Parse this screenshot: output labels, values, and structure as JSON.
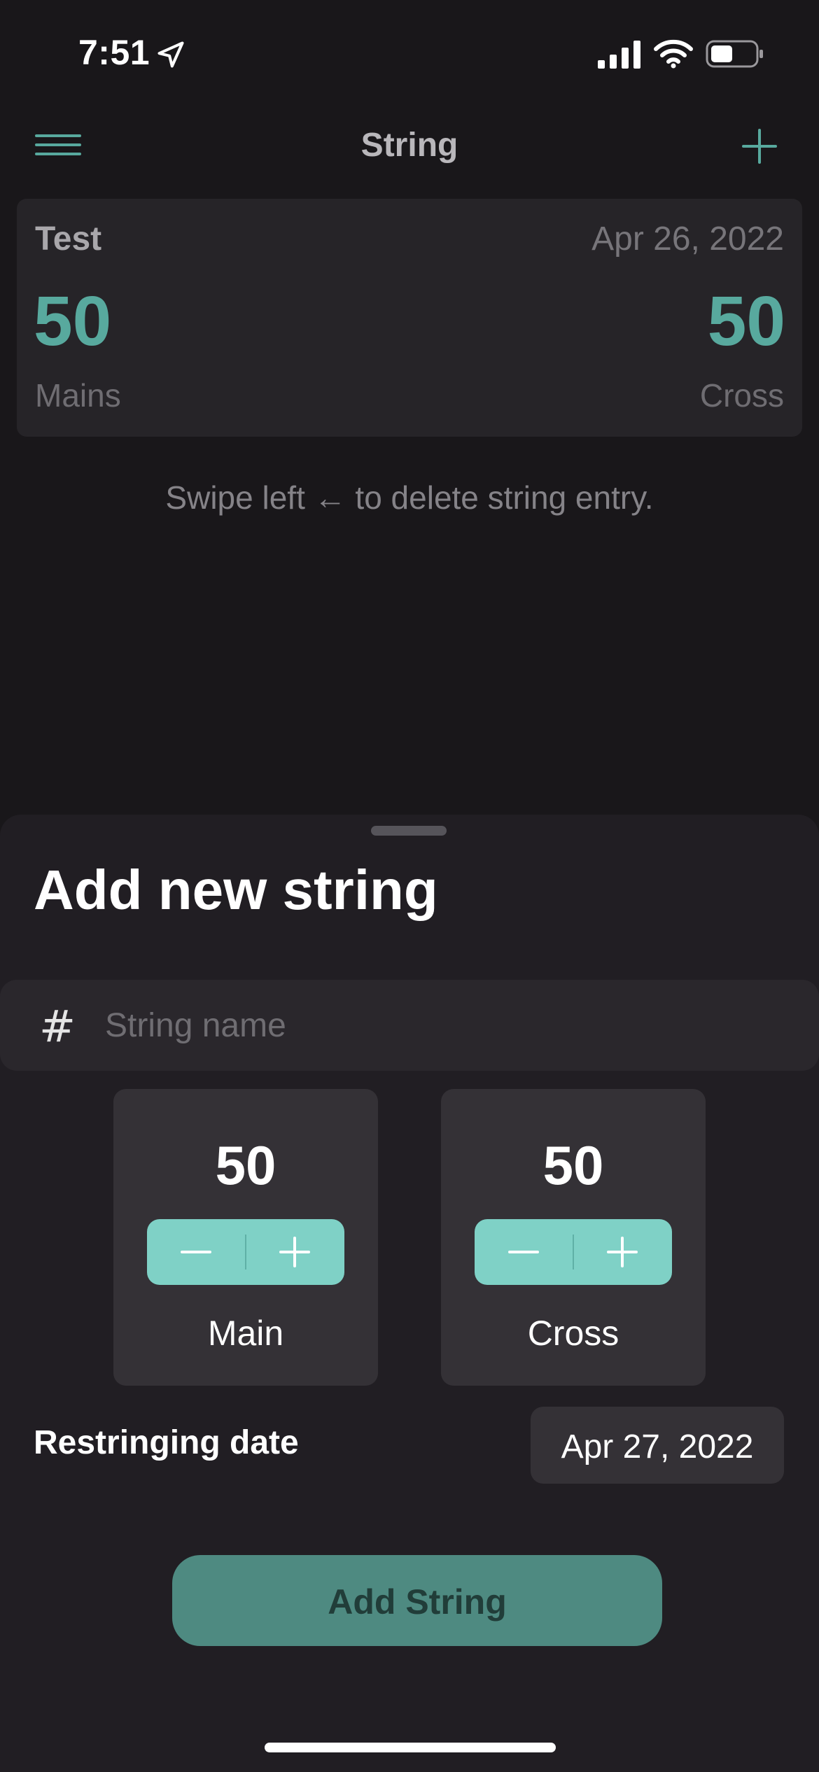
{
  "status_bar": {
    "time": "7:51",
    "icons": [
      "location-arrow-icon",
      "cellular-signal-icon",
      "wifi-icon",
      "battery-icon"
    ]
  },
  "nav": {
    "title": "String",
    "left_icon": "hamburger-menu-icon",
    "right_icon": "plus-icon"
  },
  "strings_list": [
    {
      "name": "Test",
      "date": "Apr 26, 2022",
      "mains_value": "50",
      "mains_label": "Mains",
      "cross_value": "50",
      "cross_label": "Cross"
    }
  ],
  "hint": "Swipe left ← to delete string entry.",
  "sheet": {
    "title": "Add new string",
    "name_field": {
      "icon": "#",
      "placeholder": "String name",
      "value": ""
    },
    "main_counter": {
      "value": "50",
      "label": "Main",
      "minus": "−",
      "plus": "+"
    },
    "cross_counter": {
      "value": "50",
      "label": "Cross",
      "minus": "−",
      "plus": "+"
    },
    "date_label": "Restringing date",
    "date_value": "Apr 27, 2022",
    "submit_label": "Add String"
  },
  "colors": {
    "accent": "#58a99e",
    "stepper_bg": "#7fd1c6",
    "button_bg": "#4e8a81",
    "background": "#19171a",
    "card_bg": "#262428",
    "sheet_bg": "#211e23"
  }
}
